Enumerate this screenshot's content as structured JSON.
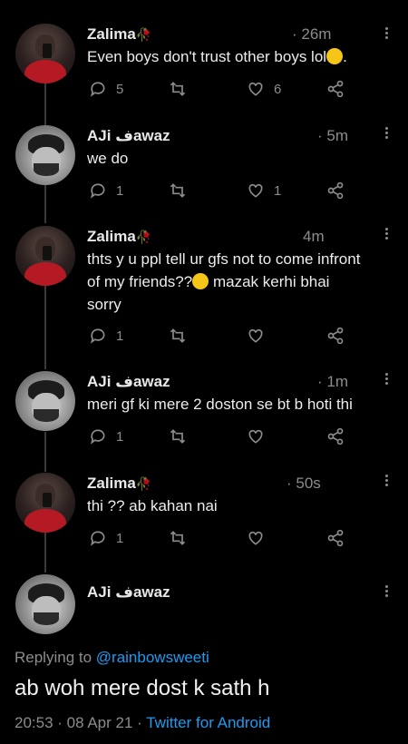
{
  "tweets": [
    {
      "name": "Zalima",
      "name_emoji": "🥀",
      "time": "· 26m",
      "text": "Even boys don't trust other boys lol",
      "text_suffix": ".",
      "replies": "5",
      "likes": "6"
    },
    {
      "name": "AJi فawaz",
      "time": "· 5m",
      "text": "we do",
      "replies": "1",
      "likes": "1"
    },
    {
      "name": "Zalima",
      "name_emoji": "🥀",
      "time": "4m",
      "text_line1": "thts y u ppl tell ur gfs not to come infront",
      "text_line2_a": "of my friends??",
      "text_line2_b": " mazak kerhi bhai",
      "text_line3": "sorry",
      "replies": "1"
    },
    {
      "name": "AJi فawaz",
      "time": "· 1m",
      "text": "meri gf ki mere 2 doston se bt b hoti thi",
      "replies": "1"
    },
    {
      "name": "Zalima",
      "name_emoji": "🥀",
      "time": "· 50s",
      "text": "thi ?? ab kahan nai",
      "replies": "1"
    },
    {
      "name": "AJi فawaz"
    }
  ],
  "reply_context": {
    "prefix": "Replying to ",
    "handle": "@rainbowsweeti"
  },
  "main_tweet": {
    "text": "ab woh mere dost k sath h",
    "timestamp": "20:53 · 08 Apr 21 · ",
    "source": "Twitter for Android"
  },
  "colors": {
    "background": "#000000",
    "link": "#1d9bf0",
    "muted": "#8c8c8c"
  },
  "icons": [
    "reply-icon",
    "retweet-icon",
    "like-icon",
    "share-icon",
    "more-icon"
  ]
}
